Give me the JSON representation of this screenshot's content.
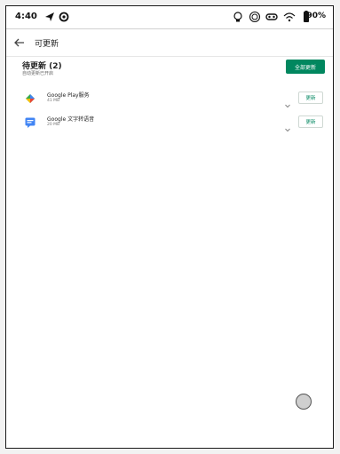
{
  "status_bar": {
    "time": "4:40",
    "battery": "90%",
    "icons": [
      "navigation-icon",
      "vpn-icon",
      "bulb-icon",
      "sync-icon",
      "key-icon",
      "wifi-icon",
      "battery-icon"
    ]
  },
  "app_bar": {
    "title": "可更新",
    "back_icon": "arrow-back-icon"
  },
  "section": {
    "title": "待更新 (2)",
    "subtitle": "自动更新已开启",
    "update_all_label": "全部更新"
  },
  "apps": [
    {
      "name": "Google Play服务",
      "size": "41 MB",
      "icon": "google-play-services-icon",
      "button_label": "更新"
    },
    {
      "name": "Google 文字转语音",
      "size": "20 MB",
      "icon": "google-tts-icon",
      "button_label": "更新"
    }
  ],
  "colors": {
    "accent": "#01875f",
    "background": "#ffffff"
  }
}
